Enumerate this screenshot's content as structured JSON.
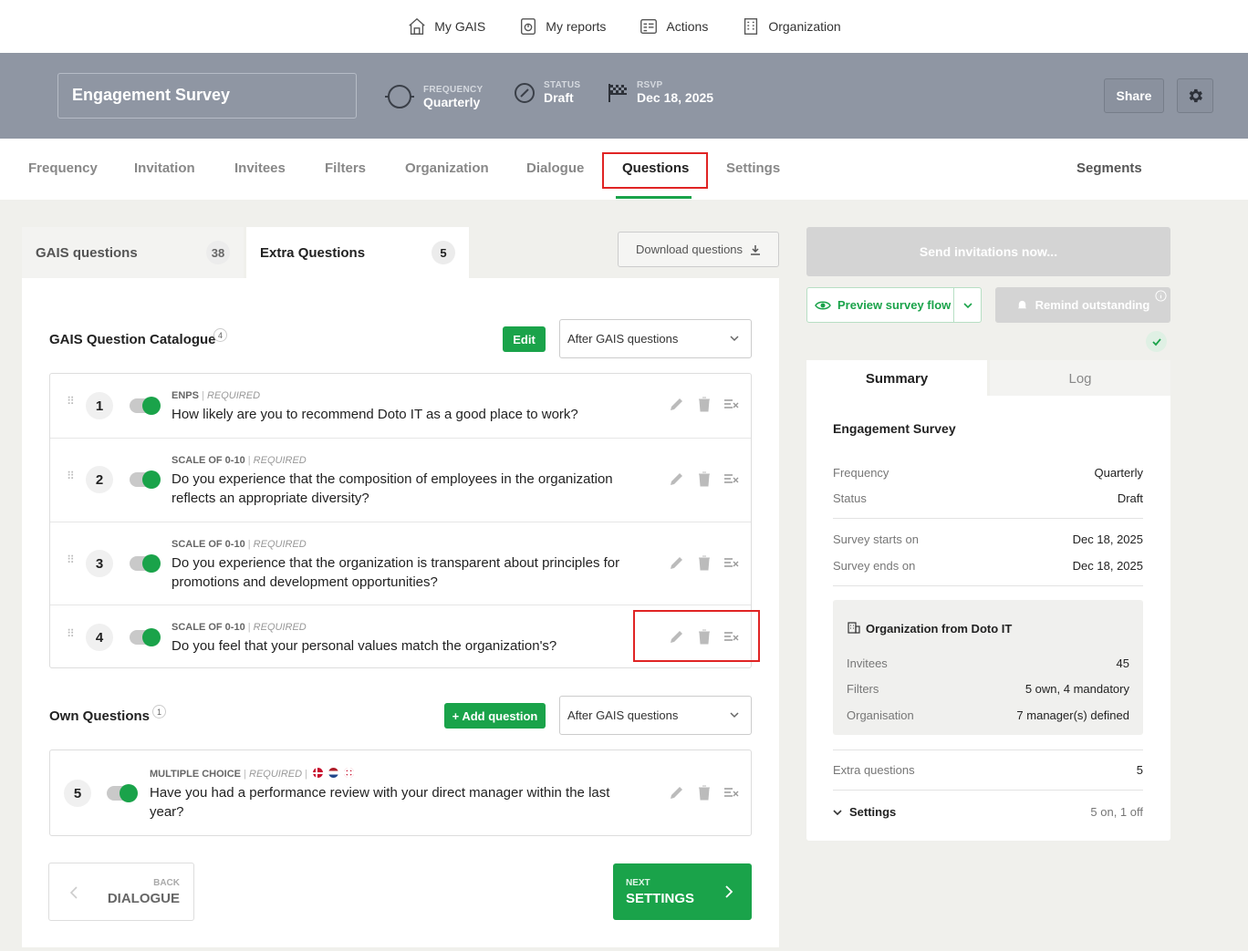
{
  "topnav": [
    {
      "label": "My GAIS",
      "icon": "home-icon"
    },
    {
      "label": "My reports",
      "icon": "reports-icon"
    },
    {
      "label": "Actions",
      "icon": "actions-icon"
    },
    {
      "label": "Organization",
      "icon": "building-icon"
    }
  ],
  "header": {
    "title": "Engagement Survey",
    "frequency_label": "FREQUENCY",
    "frequency_value": "Quarterly",
    "status_label": "STATUS",
    "status_value": "Draft",
    "rsvp_label": "RSVP",
    "rsvp_value": "Dec 18, 2025",
    "share_label": "Share"
  },
  "tabs": [
    "Frequency",
    "Invitation",
    "Invitees",
    "Filters",
    "Organization",
    "Dialogue",
    "Questions",
    "Settings",
    "Segments"
  ],
  "active_tab": "Questions",
  "subtabs": {
    "gais_label": "GAIS questions",
    "gais_count": "38",
    "extra_label": "Extra Questions",
    "extra_count": "5",
    "download_label": "Download questions"
  },
  "catalogue": {
    "title": "GAIS Question Catalogue",
    "count": "4",
    "edit_label": "Edit",
    "position": "After GAIS questions",
    "questions": [
      {
        "num": "1",
        "type": "ENPS",
        "required": "REQUIRED",
        "text": "How likely are you to recommend Doto IT as a good place to work?"
      },
      {
        "num": "2",
        "type": "SCALE OF 0-10",
        "required": "REQUIRED",
        "text": "Do you experience that the composition of employees in the organization reflects an appropriate diversity?"
      },
      {
        "num": "3",
        "type": "SCALE OF 0-10",
        "required": "REQUIRED",
        "text": "Do you experience that the organization is transparent about principles for promotions and development opportunities?"
      },
      {
        "num": "4",
        "type": "SCALE OF 0-10",
        "required": "REQUIRED",
        "text": "Do you feel that your personal values match the organization's?"
      }
    ]
  },
  "own": {
    "title": "Own Questions",
    "count": "1",
    "add_label": "+ Add question",
    "position": "After GAIS questions",
    "questions": [
      {
        "num": "5",
        "type": "MULTIPLE CHOICE",
        "required": "REQUIRED",
        "text": "Have you had a performance review with your direct manager within the last year?"
      }
    ]
  },
  "nav_buttons": {
    "back_small": "BACK",
    "back_big": "DIALOGUE",
    "next_small": "NEXT",
    "next_big": "SETTINGS"
  },
  "right": {
    "send_label": "Send invitations now...",
    "preview_label": "Preview survey flow",
    "remind_label": "Remind outstanding",
    "summary_tab": "Summary",
    "log_tab": "Log",
    "survey_title": "Engagement Survey",
    "rows": [
      {
        "k": "Frequency",
        "v": "Quarterly"
      },
      {
        "k": "Status",
        "v": "Draft"
      },
      {
        "k": "Survey starts on",
        "v": "Dec 18, 2025"
      },
      {
        "k": "Survey ends on",
        "v": "Dec 18, 2025"
      }
    ],
    "org_title": "Organization from Doto IT",
    "org_rows": [
      {
        "k": "Invitees",
        "v": "45"
      },
      {
        "k": "Filters",
        "v": "5 own, 4 mandatory"
      },
      {
        "k": "Organisation",
        "v": "7 manager(s) defined"
      }
    ],
    "extra_k": "Extra questions",
    "extra_v": "5",
    "settings_label": "Settings",
    "settings_v": "5 on, 1 off"
  },
  "colors": {
    "accent": "#1aa34a",
    "header_bg": "#8f96a3",
    "highlight": "#e02424"
  }
}
